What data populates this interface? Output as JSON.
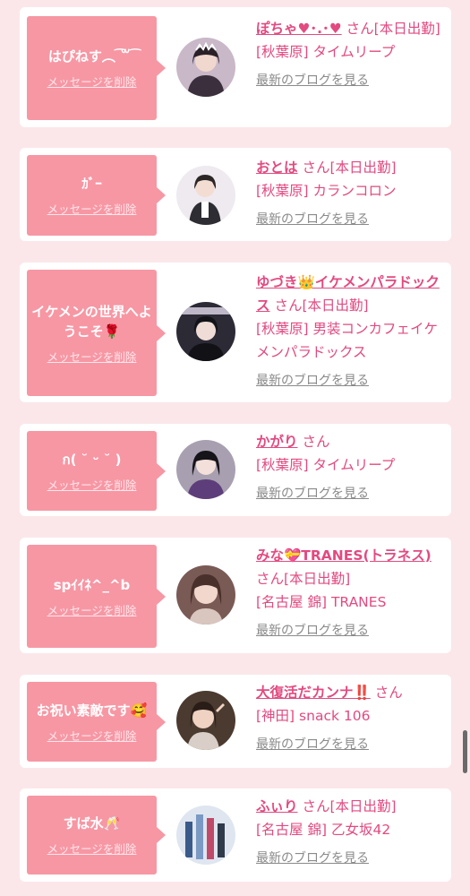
{
  "items": [
    {
      "message": "はぴねす︵ ͡꒳ ͡ ",
      "delete_label": "メッセージを削除",
      "name": "ぽちゃ♥︎･.･♥︎",
      "san": "さん",
      "status": "[本日出勤]",
      "area": "[秋葉原]",
      "store": "タイムリープ",
      "blog_label": "最新のブログを見る",
      "avatar_color": "#3b2f3d"
    },
    {
      "message": "ｶﾞｰ",
      "delete_label": "メッセージを削除",
      "name": "おとは",
      "san": "さん",
      "status": "[本日出勤]",
      "area": "[秋葉原]",
      "store": "カランコロン",
      "blog_label": "最新のブログを見る",
      "avatar_color": "#e8e3ea"
    },
    {
      "message": "イケメンの世界へようこそ🌹",
      "delete_label": "メッセージを削除",
      "name": "ゆづき👑イケメンパラドックス",
      "san": "さん",
      "status": "[本日出勤]",
      "area": "[秋葉原]",
      "store": "男装コンカフェイケメンパラドックス",
      "blog_label": "最新のブログを見る",
      "avatar_color": "#2b2a35"
    },
    {
      "message": "ก(   ˘ ᵕ ˘ )",
      "delete_label": "メッセージを削除",
      "name": "かがり",
      "san": "さん",
      "status": "",
      "area": "[秋葉原]",
      "store": "タイムリープ",
      "blog_label": "最新のブログを見る",
      "avatar_color": "#4a3a52"
    },
    {
      "message": "spｲｲﾈ^_^b",
      "delete_label": "メッセージを削除",
      "name": "みな💝TRANES(トラネス)",
      "san": "さん",
      "status": "[本日出勤]",
      "area": "[名古屋 錦]",
      "store": "TRANES",
      "blog_label": "最新のブログを見る",
      "avatar_color": "#5b3b3a"
    },
    {
      "message": "お祝い素敵です🥰",
      "delete_label": "メッセージを削除",
      "name": "大復活だカンナ‼️",
      "san": "さん",
      "status": "",
      "area": "[神田]",
      "store": "snack 106",
      "blog_label": "最新のブログを見る",
      "avatar_color": "#3a2b24"
    },
    {
      "message": "すば水🥂",
      "delete_label": "メッセージを削除",
      "name": "ふぃり",
      "san": "さん",
      "status": "[本日出勤]",
      "area": "[名古屋 錦]",
      "store": "乙女坂42",
      "blog_label": "最新のブログを見る",
      "avatar_color": "#2f3a4a"
    }
  ]
}
